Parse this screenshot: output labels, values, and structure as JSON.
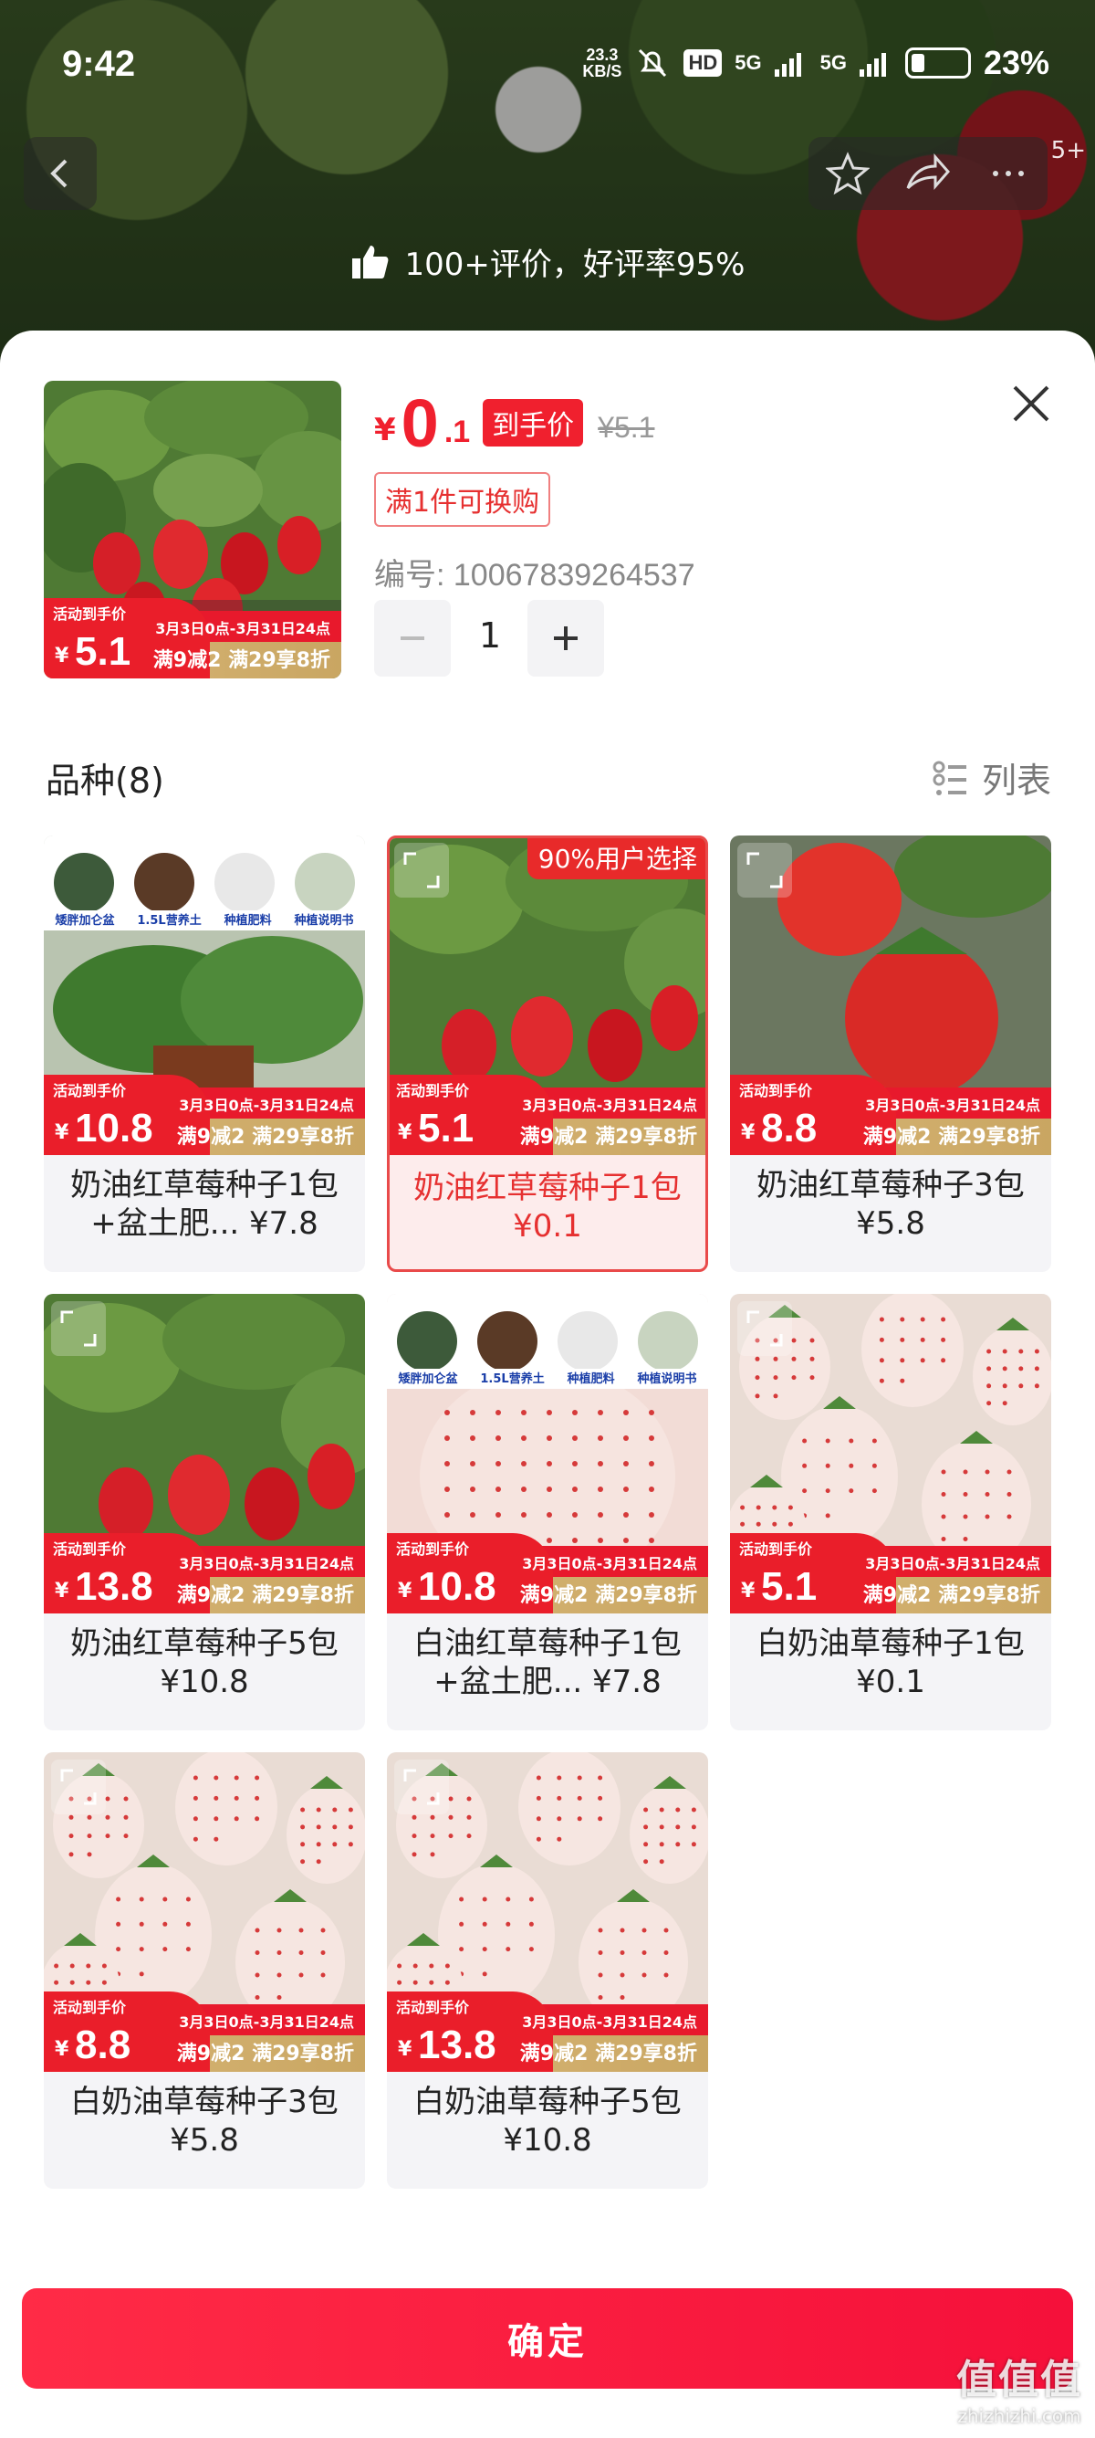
{
  "status_bar": {
    "time": "9:42",
    "net_speed_value": "23.3",
    "net_speed_unit": "KB/S",
    "hd_label": "HD",
    "signal1": "5G",
    "signal2": "5G",
    "battery": "23%"
  },
  "nav": {
    "notification_count": "5+"
  },
  "rating": {
    "text": "100+评价，好评率95%"
  },
  "product": {
    "currency": "¥",
    "price_int": "0",
    "price_dec": ".1",
    "final_price_tag": "到手价",
    "original_price": "¥5.1",
    "exchange_tag": "满1件可换购",
    "sku_label": "编号: 10067839264537",
    "quantity": "1",
    "thumb_promo": {
      "label": "活动到手价",
      "price": "5.1",
      "date": "3月3日0点-3月31日24点",
      "discount": "满9减2 满29享8折"
    }
  },
  "variants": {
    "title": "品种(8)",
    "view_toggle_label": "列表",
    "popular_badge": "90%用户选择",
    "promo_label": "活动到手价",
    "promo_yen": "¥",
    "promo_date": "3月3日0点-3月31日24点",
    "promo_discount": "满9减2 满29享8折",
    "supplies": [
      "矮胖加仑盆",
      "1.5L营养土",
      "种植肥料",
      "种植说明书"
    ],
    "items": [
      {
        "name": "奶油红草莓种子1包+盆土肥... ¥7.8",
        "promo_price": "10.8",
        "image": "pot-bundle",
        "selected": false
      },
      {
        "name": "奶油红草莓种子1包 ¥0.1",
        "promo_price": "5.1",
        "image": "red-strawberry",
        "selected": true
      },
      {
        "name": "奶油红草莓种子3包 ¥5.8",
        "promo_price": "8.8",
        "image": "red-strawberry-close",
        "selected": false
      },
      {
        "name": "奶油红草莓种子5包 ¥10.8",
        "promo_price": "13.8",
        "image": "red-strawberry",
        "selected": false
      },
      {
        "name": "白油红草莓种子1包+盆土肥... ¥7.8",
        "promo_price": "10.8",
        "image": "white-bundle",
        "selected": false
      },
      {
        "name": "白奶油草莓种子1包 ¥0.1",
        "promo_price": "5.1",
        "image": "white-strawberry",
        "selected": false
      },
      {
        "name": "白奶油草莓种子3包 ¥5.8",
        "promo_price": "8.8",
        "image": "white-strawberry",
        "selected": false
      },
      {
        "name": "白奶油草莓种子5包 ¥10.8",
        "promo_price": "13.8",
        "image": "white-strawberry",
        "selected": false
      }
    ]
  },
  "confirm_button": "确定",
  "watermark": {
    "big": "值值值",
    "small": "zhizhizhi.com"
  },
  "colors": {
    "accent": "#f0202e",
    "gold": "#d9b778",
    "confirm": "#ff2b46"
  }
}
